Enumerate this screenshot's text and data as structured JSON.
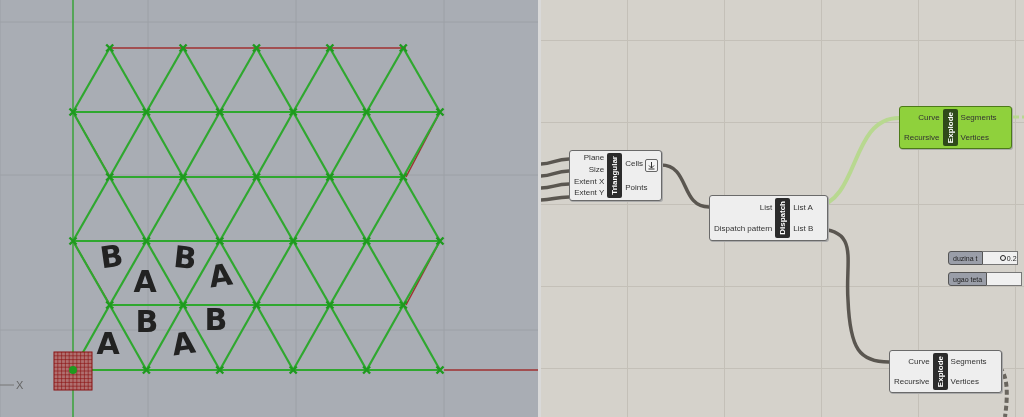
{
  "viewport": {
    "axis_label": "X",
    "letters": [
      "B",
      "A",
      "B",
      "A",
      "A",
      "B",
      "A",
      "B"
    ]
  },
  "canvas": {
    "components": [
      {
        "name": "Triangular",
        "inputs": [
          "Plane",
          "Size",
          "Extent X",
          "Extent Y"
        ],
        "outputs": [
          "Cells",
          "Points"
        ],
        "selected": false
      },
      {
        "name": "Dispatch",
        "inputs": [
          "List",
          "Dispatch pattern"
        ],
        "outputs": [
          "List A",
          "List B"
        ],
        "selected": false
      },
      {
        "name": "Explode",
        "inputs": [
          "Curve",
          "Recursive"
        ],
        "outputs": [
          "Segments",
          "Vertices"
        ],
        "selected": true
      },
      {
        "name": "Explode",
        "inputs": [
          "Curve",
          "Recursive"
        ],
        "outputs": [
          "Segments",
          "Vertices"
        ],
        "selected": false
      }
    ],
    "sliders": [
      {
        "label": "duzina t",
        "value": "0.2"
      },
      {
        "label": "ugao teta"
      }
    ]
  }
}
